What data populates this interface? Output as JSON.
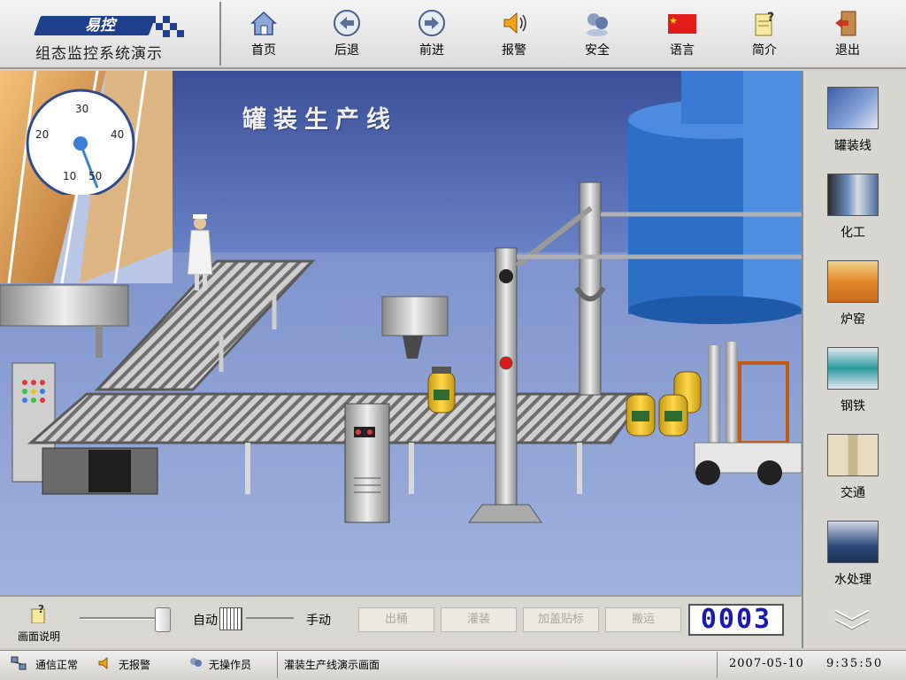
{
  "header": {
    "logo_text": "易控",
    "subtitle": "组态监控系统演示"
  },
  "toolbar": [
    {
      "id": "home",
      "label": "首页",
      "icon": "house-icon"
    },
    {
      "id": "back",
      "label": "后退",
      "icon": "arrow-left-icon"
    },
    {
      "id": "forward",
      "label": "前进",
      "icon": "arrow-right-icon"
    },
    {
      "id": "alarm",
      "label": "报警",
      "icon": "speaker-icon"
    },
    {
      "id": "security",
      "label": "安全",
      "icon": "users-icon"
    },
    {
      "id": "language",
      "label": "语言",
      "icon": "china-flag-icon"
    },
    {
      "id": "intro",
      "label": "简介",
      "icon": "notepad-question-icon"
    },
    {
      "id": "exit",
      "label": "退出",
      "icon": "door-exit-icon"
    }
  ],
  "scene": {
    "title": "罐装生产线",
    "gauge": {
      "ticks": [
        "30",
        "40",
        "50",
        "10",
        "20"
      ],
      "value_label": "gauge"
    }
  },
  "sidebar": {
    "items": [
      {
        "label": "罐装线",
        "icon": "canning-line-thumb"
      },
      {
        "label": "化工",
        "icon": "chemical-thumb"
      },
      {
        "label": "炉窑",
        "icon": "furnace-thumb"
      },
      {
        "label": "钢铁",
        "icon": "steel-thumb"
      },
      {
        "label": "交通",
        "icon": "traffic-thumb"
      },
      {
        "label": "水处理",
        "icon": "water-treatment-thumb"
      }
    ],
    "more_icon": "double-chevron-down-icon"
  },
  "controls": {
    "help_label": "画面说明",
    "auto_label": "自动",
    "manual_label": "手动",
    "buttons": [
      "出桶",
      "灌装",
      "加盖贴标",
      "搬运"
    ],
    "counter": "0003"
  },
  "status": {
    "comm": "通信正常",
    "alarm": "无报警",
    "operator": "无操作员",
    "screen": "灌装生产线演示画面",
    "date": "2007-05-10",
    "time": "9:35:50"
  },
  "colors": {
    "logo_blue": "#1d3f8c",
    "counter_digits": "#1a1ab0",
    "scene_sky": "#4a5fa8"
  }
}
